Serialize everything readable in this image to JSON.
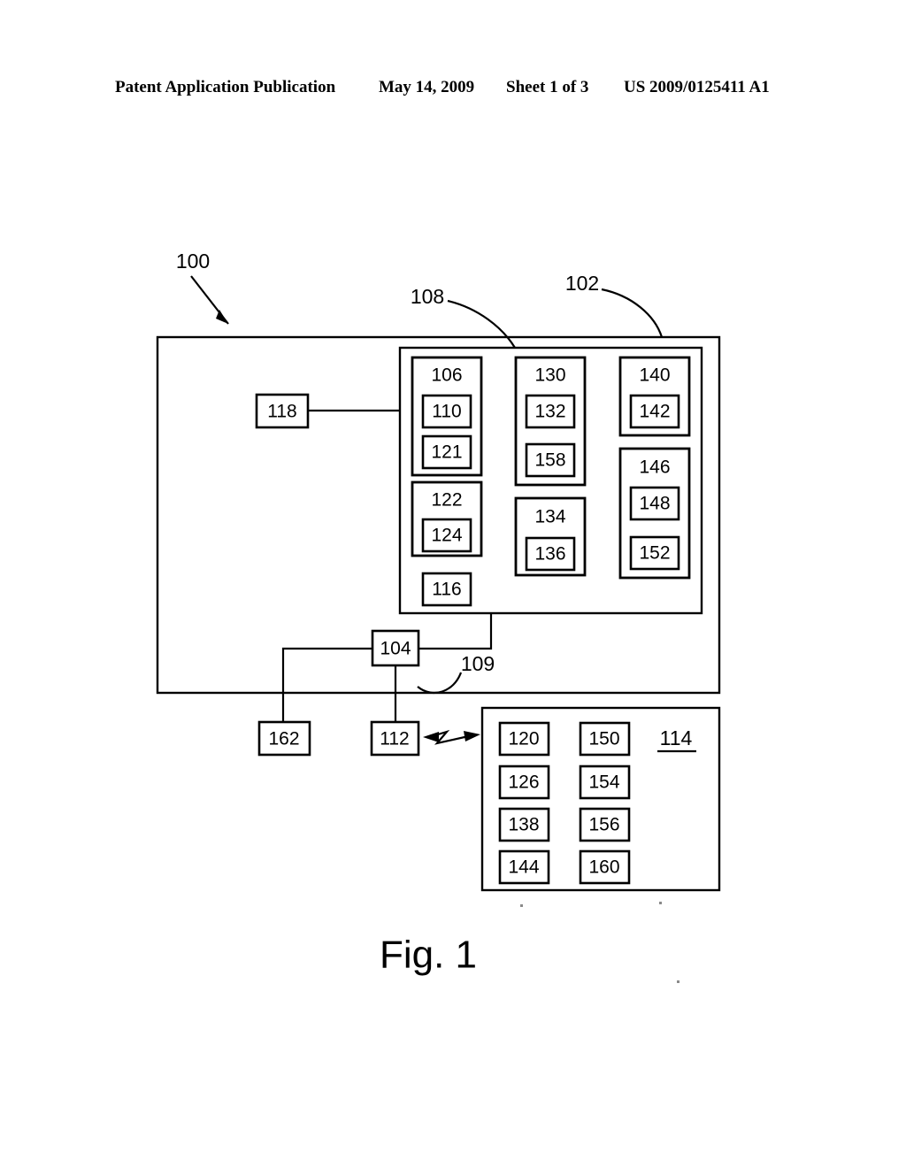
{
  "header": {
    "publication": "Patent Application Publication",
    "date": "May 14, 2009",
    "sheet": "Sheet 1 of 3",
    "patent_number": "US 2009/0125411 A1"
  },
  "figure": {
    "caption": "Fig. 1",
    "callouts": {
      "system": "100",
      "outer_enclosure": "102",
      "inner_enclosure": "108",
      "bus_109": "109",
      "remote_panel": "114"
    }
  },
  "boxes": {
    "b100": "100",
    "b102": "102",
    "b104": "104",
    "b106": "106",
    "b108": "108",
    "b109": "109",
    "b110": "110",
    "b112": "112",
    "b114": "114",
    "b116": "116",
    "b118": "118",
    "b120": "120",
    "b121": "121",
    "b122": "122",
    "b124": "124",
    "b126": "126",
    "b130": "130",
    "b132": "132",
    "b134": "134",
    "b136": "136",
    "b138": "138",
    "b140": "140",
    "b142": "142",
    "b144": "144",
    "b146": "146",
    "b148": "148",
    "b150": "150",
    "b152": "152",
    "b154": "154",
    "b156": "156",
    "b158": "158",
    "b160": "160",
    "b162": "162"
  },
  "chart_data": {
    "type": "diagram",
    "title": "Fig. 1",
    "description": "Patent block diagram: system 100 with outer enclosure 102 containing inner enclosure 108 and connected peripheral blocks.",
    "nodes": [
      {
        "id": "100",
        "role": "system-callout",
        "parent": null
      },
      {
        "id": "102",
        "role": "outer-enclosure",
        "parent": "100"
      },
      {
        "id": "108",
        "role": "inner-enclosure",
        "parent": "102"
      },
      {
        "id": "106",
        "role": "group",
        "parent": "108",
        "children": [
          "110",
          "121"
        ]
      },
      {
        "id": "110",
        "role": "block",
        "parent": "106"
      },
      {
        "id": "121",
        "role": "block",
        "parent": "106"
      },
      {
        "id": "122",
        "role": "group",
        "parent": "108",
        "children": [
          "124"
        ]
      },
      {
        "id": "124",
        "role": "block",
        "parent": "122"
      },
      {
        "id": "116",
        "role": "block",
        "parent": "108"
      },
      {
        "id": "130",
        "role": "group",
        "parent": "108",
        "children": [
          "132",
          "158"
        ]
      },
      {
        "id": "132",
        "role": "block",
        "parent": "130"
      },
      {
        "id": "158",
        "role": "block",
        "parent": "130"
      },
      {
        "id": "134",
        "role": "group",
        "parent": "108",
        "children": [
          "136"
        ]
      },
      {
        "id": "136",
        "role": "block",
        "parent": "134"
      },
      {
        "id": "140",
        "role": "group",
        "parent": "108",
        "children": [
          "142"
        ]
      },
      {
        "id": "142",
        "role": "block",
        "parent": "140"
      },
      {
        "id": "146",
        "role": "group",
        "parent": "108",
        "children": [
          "148",
          "152"
        ]
      },
      {
        "id": "148",
        "role": "block",
        "parent": "146"
      },
      {
        "id": "152",
        "role": "block",
        "parent": "146"
      },
      {
        "id": "118",
        "role": "block",
        "parent": "102"
      },
      {
        "id": "104",
        "role": "block",
        "parent": "102"
      },
      {
        "id": "109",
        "role": "bus-callout",
        "parent": "102"
      },
      {
        "id": "162",
        "role": "block",
        "parent": null
      },
      {
        "id": "112",
        "role": "block",
        "parent": null
      },
      {
        "id": "114",
        "role": "remote-panel",
        "parent": null,
        "children": [
          "120",
          "126",
          "138",
          "144",
          "150",
          "154",
          "156",
          "160"
        ]
      },
      {
        "id": "120",
        "role": "block",
        "parent": "114"
      },
      {
        "id": "126",
        "role": "block",
        "parent": "114"
      },
      {
        "id": "138",
        "role": "block",
        "parent": "114"
      },
      {
        "id": "144",
        "role": "block",
        "parent": "114"
      },
      {
        "id": "150",
        "role": "block",
        "parent": "114"
      },
      {
        "id": "154",
        "role": "block",
        "parent": "114"
      },
      {
        "id": "156",
        "role": "block",
        "parent": "114"
      },
      {
        "id": "160",
        "role": "block",
        "parent": "114"
      }
    ],
    "edges": [
      {
        "from": "118",
        "to": "108",
        "type": "wired"
      },
      {
        "from": "104",
        "to": "108",
        "type": "wired"
      },
      {
        "from": "104",
        "to": "162",
        "type": "wired"
      },
      {
        "from": "104",
        "to": "112",
        "type": "wired"
      },
      {
        "from": "112",
        "to": "114",
        "type": "wireless",
        "bidirectional": true
      }
    ]
  }
}
